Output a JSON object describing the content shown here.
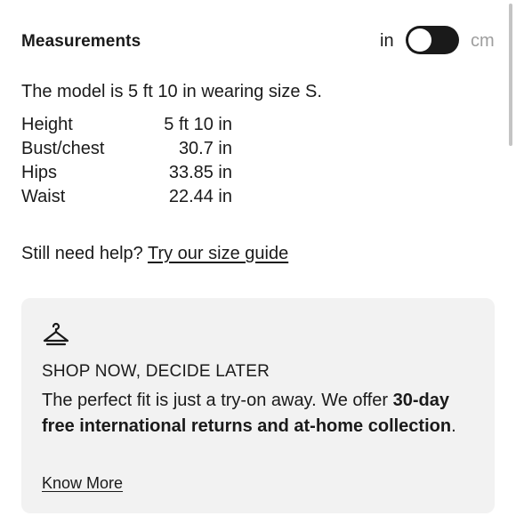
{
  "header": {
    "title": "Measurements",
    "unit_in": "in",
    "unit_cm": "cm",
    "selected_unit": "in"
  },
  "model_text": "The model is 5 ft 10 in wearing size S.",
  "measurements": [
    {
      "label": "Height",
      "value": "5 ft 10 in"
    },
    {
      "label": "Bust/chest",
      "value": "30.7 in"
    },
    {
      "label": "Hips",
      "value": "33.85 in"
    },
    {
      "label": "Waist",
      "value": "22.44 in"
    }
  ],
  "help": {
    "prompt": "Still need help?",
    "link": "Try our size guide"
  },
  "promo": {
    "icon": "hanger-icon",
    "heading": "SHOP NOW, DECIDE LATER",
    "body_prefix": "The perfect fit is just a try-on away. We offer ",
    "body_bold": "30-day free international returns and at-home collection",
    "body_suffix": ".",
    "link": "Know More"
  },
  "colors": {
    "text": "#1a1a1a",
    "toggle_bg": "#1a1a1a",
    "unselected_unit": "#9e9e9e",
    "card_bg": "#f2f2f2"
  }
}
